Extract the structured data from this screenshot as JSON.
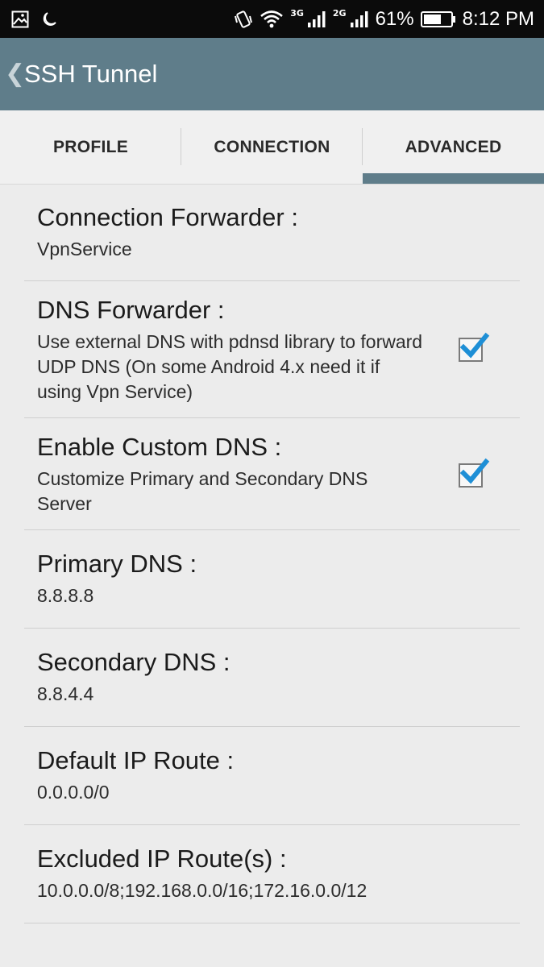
{
  "status_bar": {
    "battery_percent": "61%",
    "time": "8:12 PM",
    "net1": "3G",
    "net2": "2G",
    "icons": [
      "image-icon",
      "moon-icon",
      "vibrate-icon",
      "wifi-icon",
      "signal-3g-icon",
      "signal-2g-icon",
      "battery-icon"
    ]
  },
  "app_bar": {
    "back_symbol": "❮",
    "title": "SSH Tunnel"
  },
  "tabs": [
    {
      "label": "PROFILE",
      "selected": false
    },
    {
      "label": "CONNECTION",
      "selected": false
    },
    {
      "label": "ADVANCED",
      "selected": true
    }
  ],
  "accent_color": "#5f7d8a",
  "checkbox_color": "#1e8fd6",
  "settings": [
    {
      "title": "Connection Forwarder :",
      "value": "VpnService"
    },
    {
      "title": "DNS Forwarder :",
      "value": "Use external DNS with pdnsd library to forward UDP DNS (On some Android 4.x need it if using Vpn Service)",
      "checked": true
    },
    {
      "title": "Enable Custom DNS :",
      "value": "Customize Primary and Secondary DNS Server",
      "checked": true
    },
    {
      "title": "Primary DNS :",
      "value": "8.8.8.8"
    },
    {
      "title": "Secondary DNS :",
      "value": "8.8.4.4"
    },
    {
      "title": "Default IP Route :",
      "value": "0.0.0.0/0"
    },
    {
      "title": "Excluded IP Route(s) :",
      "value": "10.0.0.0/8;192.168.0.0/16;172.16.0.0/12"
    }
  ]
}
